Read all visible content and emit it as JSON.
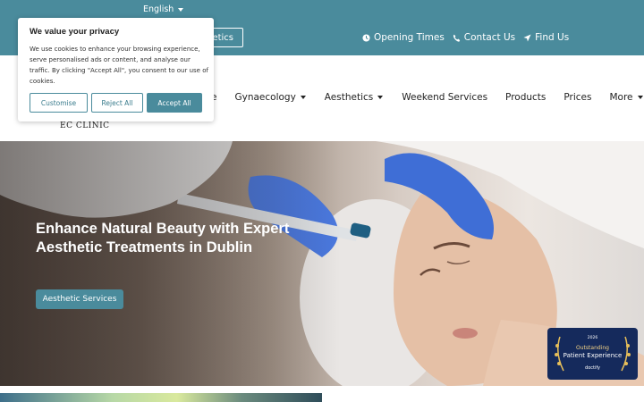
{
  "topbar": {
    "language": "English",
    "button_partial": "etics",
    "links": [
      {
        "icon": "clock-icon",
        "label": "Opening Times"
      },
      {
        "icon": "phone-icon",
        "label": "Contact Us"
      },
      {
        "icon": "location-arrow-icon",
        "label": "Find Us"
      }
    ]
  },
  "logo": {
    "text": "EC CLINIC"
  },
  "nav": {
    "partial_item": "e",
    "items": [
      {
        "label": "Gynaecology",
        "dropdown": true
      },
      {
        "label": "Aesthetics",
        "dropdown": true
      },
      {
        "label": "Weekend Services",
        "dropdown": false
      },
      {
        "label": "Products",
        "dropdown": false
      },
      {
        "label": "Prices",
        "dropdown": false
      },
      {
        "label": "More",
        "dropdown": true
      }
    ]
  },
  "hero": {
    "title": "Enhance Natural Beauty with Expert Aesthetic Treatments in Dublin",
    "button": "Aesthetic Services"
  },
  "badge": {
    "year": "2026",
    "line1": "Outstanding",
    "line2": "Patient Experience",
    "brand": "doctify"
  },
  "cookie": {
    "title": "We value your privacy",
    "body": "We use cookies to enhance your browsing experience, serve personalised ads or content, and analyse our traffic. By clicking \"Accept All\", you consent to our use of cookies.",
    "customise": "Customise",
    "reject": "Reject All",
    "accept": "Accept All"
  },
  "colors": {
    "brand_teal": "#4a8b9c",
    "badge_navy": "#152a5c",
    "badge_gold": "#f5d486"
  }
}
